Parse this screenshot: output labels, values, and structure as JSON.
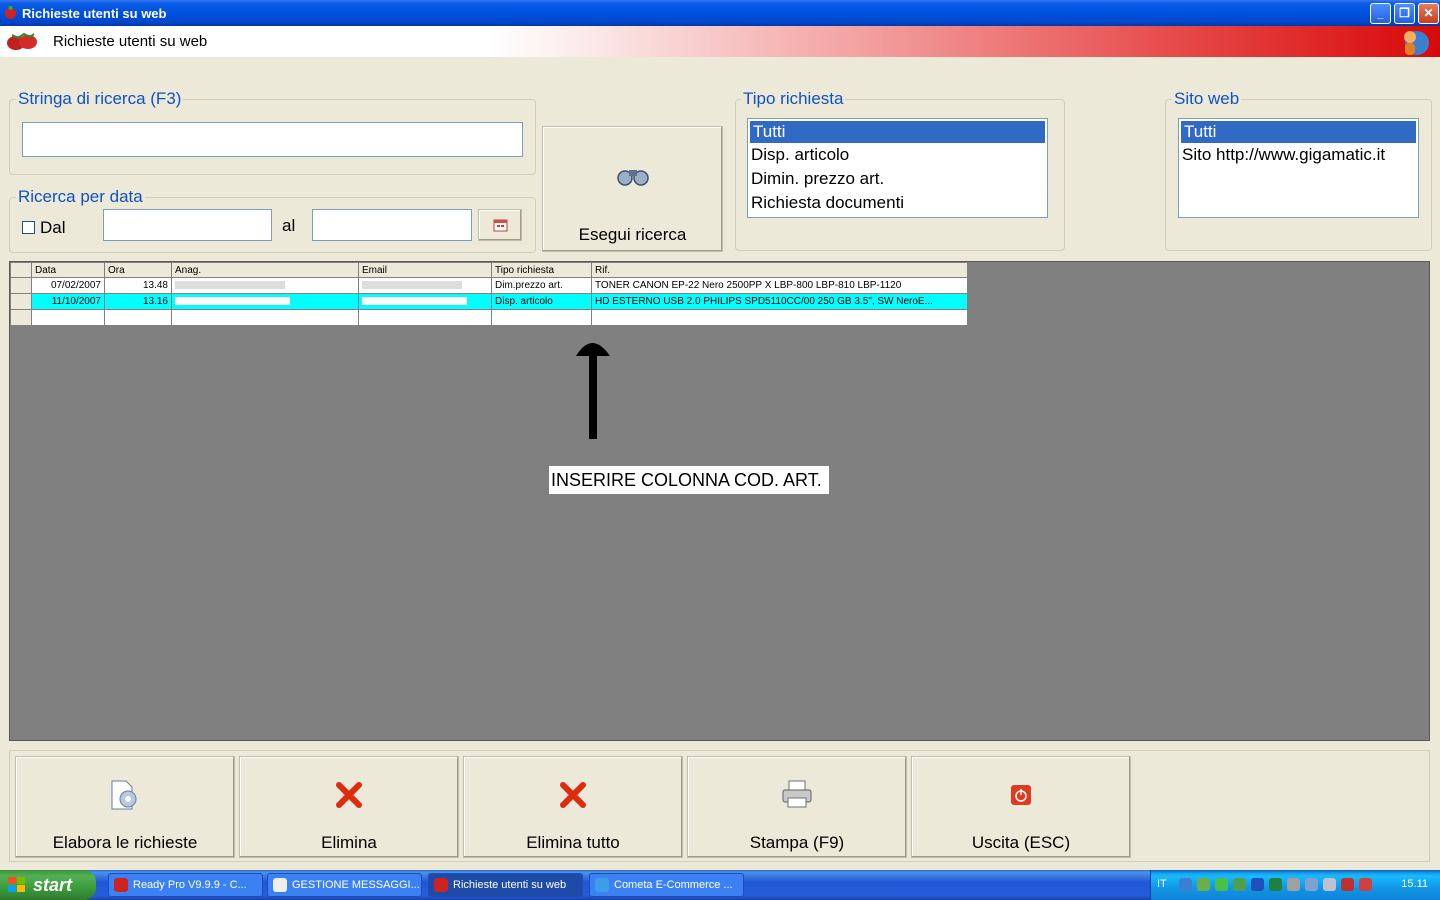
{
  "window": {
    "title": "Richieste utenti su web"
  },
  "header": {
    "title": "Richieste utenti su web"
  },
  "search": {
    "group_label": "Stringa di ricerca (F3)",
    "value": "",
    "date_group_label": "Ricerca per data",
    "dal_label": "Dal",
    "dal_checked": false,
    "al_label": "al",
    "date_from": "",
    "date_to": "",
    "run_button": "Esegui ricerca"
  },
  "tipo_richiesta": {
    "label": "Tipo richiesta",
    "items": [
      "Tutti",
      "Disp. articolo",
      "Dimin. prezzo art.",
      "Richiesta documenti"
    ],
    "selected": "Tutti"
  },
  "sito_web": {
    "label": "Sito web",
    "items": [
      "Tutti",
      "Sito http://www.gigamatic.it"
    ],
    "selected": "Tutti"
  },
  "grid": {
    "columns": [
      "Data",
      "Ora",
      "Anag.",
      "Email",
      "Tipo richiesta",
      "Rif."
    ],
    "rows": [
      {
        "data": "07/02/2007",
        "ora": "13.48",
        "tipo": "Dim.prezzo art.",
        "rif": "TONER CANON EP-22 Nero 2500PP X LBP-800 LBP-810 LBP-1120"
      },
      {
        "data": "11/10/2007",
        "ora": "13.16",
        "tipo": "Disp. articolo",
        "rif": "HD ESTERNO USB 2.0 PHILIPS SPD5110CC/00 250 GB 3.5\", SW NeroE..."
      }
    ]
  },
  "annotation": "INSERIRE COLONNA COD. ART.",
  "buttons": {
    "elabora": "Elabora le richieste",
    "elimina": "Elimina",
    "elimina_tutto": "Elimina tutto",
    "stampa": "Stampa (F9)",
    "uscita": "Uscita (ESC)"
  },
  "taskbar": {
    "start": "start",
    "tasks": [
      "Ready Pro V9.9.9 - C...",
      "GESTIONE MESSAGGI...",
      "Richieste utenti su web",
      "Cometa E-Commerce ..."
    ],
    "lang": "IT",
    "time": "15.11"
  },
  "colors": {
    "title_bar": "#0050e0",
    "selection": "#316ac5",
    "row_highlight": "#00ffff",
    "label_blue": "#1050c8"
  }
}
